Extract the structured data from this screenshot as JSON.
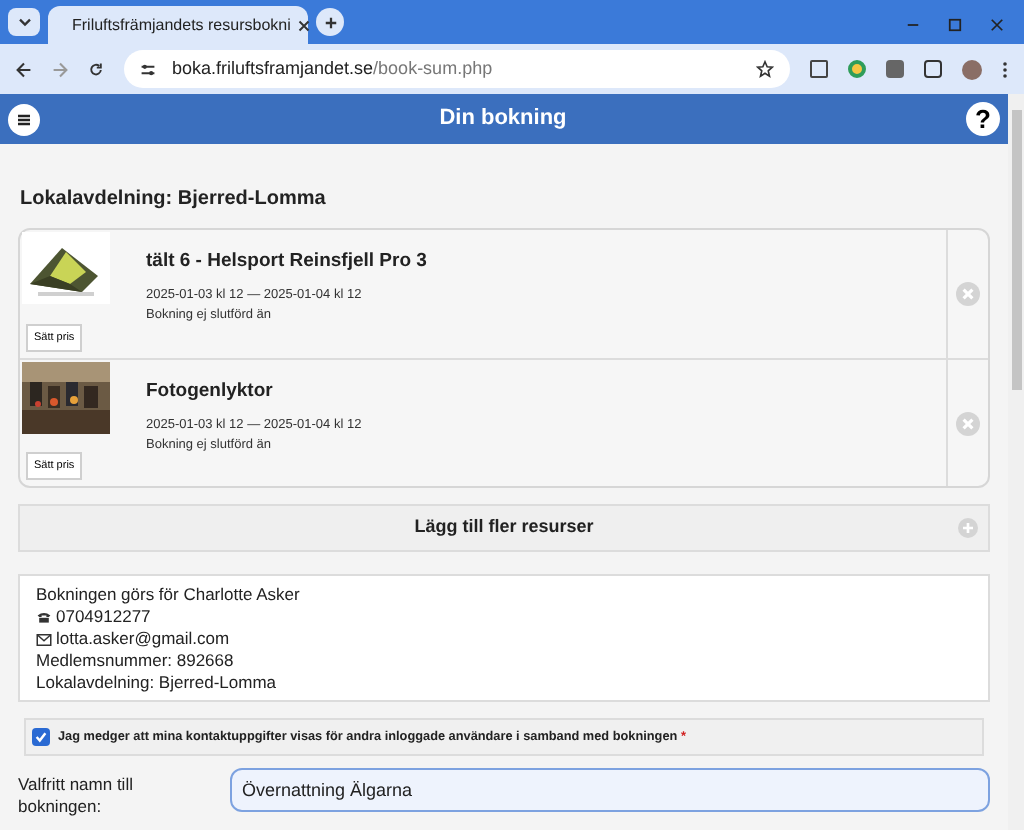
{
  "browser": {
    "tab_title": "Friluftsfrämjandets resursbokni",
    "url_host": "boka.friluftsframjandet.se",
    "url_path": "/book-sum.php"
  },
  "header": {
    "title": "Din bokning",
    "help": "?"
  },
  "local_branch": "Lokalavdelning: Bjerred-Lomma",
  "resources": [
    {
      "name": "tält 6 - Helsport Reinsfjell Pro 3",
      "dates": "2025-01-03 kl 12 — 2025-01-04 kl 12",
      "status": "Bokning ej slutförd än",
      "price_button": "Sätt pris"
    },
    {
      "name": "Fotogenlyktor",
      "dates": "2025-01-03 kl 12 — 2025-01-04 kl 12",
      "status": "Bokning ej slutförd än",
      "price_button": "Sätt pris"
    }
  ],
  "add_more": "Lägg till fler resurser",
  "contact": {
    "lines": [
      {
        "kind": "text",
        "text": "Bokningen görs för Charlotte Asker"
      },
      {
        "kind": "phone",
        "text": "0704912277"
      },
      {
        "kind": "email",
        "text": "lotta.asker@gmail.com"
      },
      {
        "kind": "text",
        "text": "Medlemsnummer: 892668"
      },
      {
        "kind": "text",
        "text": "Lokalavdelning: Bjerred-Lomma"
      }
    ]
  },
  "consent": {
    "label": "Jag medger att mina kontaktuppgifter visas för andra inloggade användare i samband med bokningen",
    "required_mark": "*",
    "checked": true
  },
  "booking_name": {
    "label": "Valfritt namn till bokningen:",
    "value": "Övernattning Älgarna"
  }
}
